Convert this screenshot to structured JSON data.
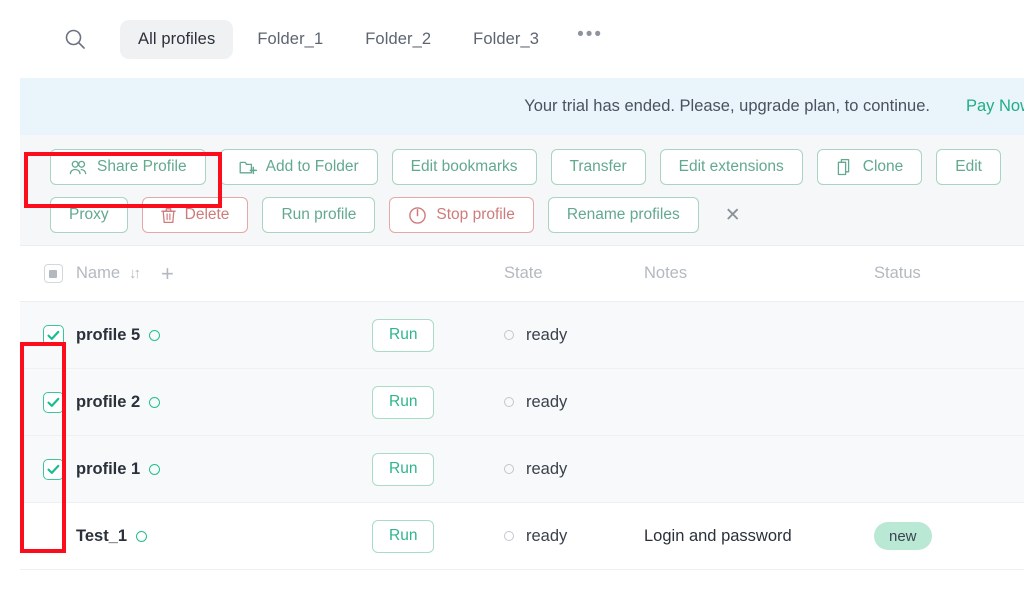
{
  "tabs": {
    "search_icon": "search-icon",
    "items": [
      {
        "label": "All profiles",
        "active": true
      },
      {
        "label": "Folder_1",
        "active": false
      },
      {
        "label": "Folder_2",
        "active": false
      },
      {
        "label": "Folder_3",
        "active": false
      }
    ],
    "more": "•••"
  },
  "banner": {
    "message": "Your trial has ended. Please, upgrade plan, to continue.",
    "cta": "Pay Now",
    "bg_color": "#eaf4fb",
    "cta_color": "#1fae84"
  },
  "toolbar": {
    "row1": [
      {
        "label": "Share Profile",
        "icon": "people-icon",
        "style": "green",
        "highlighted": true
      },
      {
        "label": "Add to Folder",
        "icon": "folder-add-icon",
        "style": "green"
      },
      {
        "label": "Edit bookmarks",
        "icon": "",
        "style": "green"
      },
      {
        "label": "Transfer",
        "icon": "",
        "style": "green"
      },
      {
        "label": "Edit extensions",
        "icon": "",
        "style": "green"
      },
      {
        "label": "Clone",
        "icon": "copy-icon",
        "style": "green"
      },
      {
        "label": "Edit",
        "icon": "",
        "style": "green"
      }
    ],
    "row2": [
      {
        "label": "Proxy",
        "icon": "",
        "style": "green"
      },
      {
        "label": "Delete",
        "icon": "trash-icon",
        "style": "red"
      },
      {
        "label": "Run profile",
        "icon": "",
        "style": "green"
      },
      {
        "label": "Stop profile",
        "icon": "power-icon",
        "style": "red"
      },
      {
        "label": "Rename profiles",
        "icon": "",
        "style": "green"
      }
    ],
    "close_label": "✕",
    "green_color": "#63a98e",
    "red_color": "#cf7b7b"
  },
  "table": {
    "headers": {
      "name": "Name",
      "state": "State",
      "notes": "Notes",
      "status": "Status",
      "sort_icon": "↓↑",
      "add_icon": "+"
    },
    "rows": [
      {
        "name": "profile 5",
        "checked": true,
        "selected": true,
        "run": "Run",
        "state": "ready",
        "notes": "",
        "status": ""
      },
      {
        "name": "profile 2",
        "checked": true,
        "selected": true,
        "run": "Run",
        "state": "ready",
        "notes": "",
        "status": ""
      },
      {
        "name": "profile 1",
        "checked": true,
        "selected": true,
        "run": "Run",
        "state": "ready",
        "notes": "",
        "status": ""
      },
      {
        "name": "Test_1",
        "checked": false,
        "selected": false,
        "run": "Run",
        "state": "ready",
        "notes": "Login and password",
        "status": "new"
      }
    ]
  },
  "annotations": {
    "share_profile_box": "red-highlight-share-profile",
    "checkbox_column_box": "red-highlight-checkbox-column",
    "color": "#fc0d1b"
  }
}
